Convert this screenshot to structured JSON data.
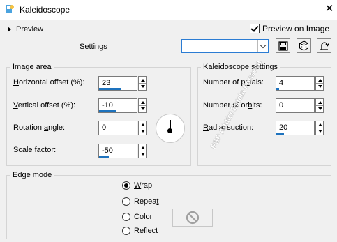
{
  "window": {
    "title": "Kaleidoscope",
    "icon": "psp-app-icon",
    "close_glyph": "✕"
  },
  "top": {
    "preview_toggle_label": "Preview",
    "preview_on_image_label": "Preview on Image",
    "preview_on_image_checked": true,
    "settings_label": "Settings",
    "preset_value": "",
    "toolbar_icons": [
      "save-preset-icon",
      "randomize-dice-icon",
      "reset-defaults-icon"
    ]
  },
  "image_area": {
    "title": "Image area",
    "horizontal_offset": {
      "label_u": "H",
      "label_rest": "orizontal offset (%):",
      "value": "23",
      "fill": 0.6
    },
    "vertical_offset": {
      "label_u": "V",
      "label_rest": "ertical offset (%):",
      "value": "-10",
      "fill": 0.45
    },
    "rotation_angle": {
      "label_a": "Rotation ",
      "label_u": "a",
      "label_rest": "ngle:",
      "value": "0"
    },
    "scale_factor": {
      "label_u": "S",
      "label_rest": "cale factor:",
      "value": "-50",
      "fill": 0.25
    }
  },
  "kaleidoscope_settings": {
    "title": "Kaleidoscope settings",
    "petals": {
      "label_a": "Number of p",
      "label_u": "e",
      "label_rest": "tals:",
      "value": "4",
      "fill": 0.08
    },
    "orbits": {
      "label_a": "Number of or",
      "label_u": "b",
      "label_rest": "its:",
      "value": "0"
    },
    "radial_suction": {
      "label_u": "R",
      "label_rest": "adial suction:",
      "value": "20",
      "fill": 0.2
    }
  },
  "edge_mode": {
    "title": "Edge mode",
    "options": [
      {
        "u": "W",
        "rest": "rap",
        "selected": true
      },
      {
        "pre": "Repea",
        "u": "t",
        "rest": "",
        "selected": false
      },
      {
        "pre": "",
        "u": "C",
        "rest": "olor",
        "selected": false
      },
      {
        "pre": "Re",
        "u": "f",
        "rest": "lect",
        "selected": false
      }
    ],
    "color_swatch_icon": "no-color-icon"
  },
  "watermark": "PSP Addict Estela Fonseca",
  "colors": {
    "accent": "#1e73be",
    "background": "#f0f0f0",
    "focus_border": "#2b7cd3"
  }
}
